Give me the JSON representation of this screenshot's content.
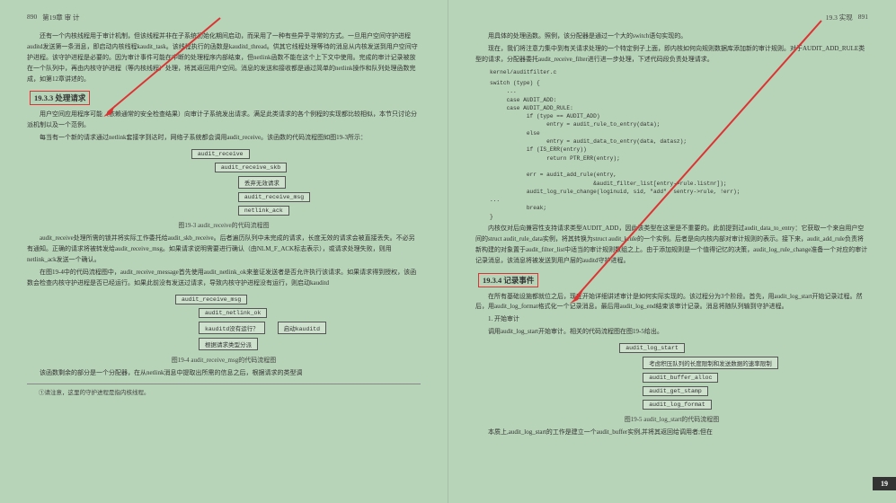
{
  "left_page": {
    "header": {
      "number": "890",
      "chapter": "第19章 审 计"
    },
    "intro_para": "还有一个内核线程用于审计机制，但该线程并非在子系统初始化期间启动，而采用了一种有些异乎寻常的方式。一旦用户空间守护进程auditd发送第一条消息，即启动内核线程kaudit_task。该线程执行的函数是kauditd_thread。供其它线程处理等待的消息从内核发送到用户空间守护进程。该守护进程是必要的。因为审计事件可能在中断的处理程序内部结束，但netlink函数不能在这个上下文中使用。完成的审计记录被放在一个队列中，再由内核守护进程（等内核线程）处理，将其返回用户空间。消息的发送和接收都是通过简单的netlink操作和队列处理函数完成，如第12章讲述的。",
    "section_1933": {
      "num": "19.3.3",
      "title": "处理请求"
    },
    "p1933a": "用户空间应用程序可能（依赖通常的安全检查结果）向审计子系统发出请求。满足此类请求的各个例程的实现都比较相似，本节只讨论分派机制以及一个范例。",
    "p1933b": "每当有一个新的请求通过netlink套接字到达时，网络子系统都会调用audit_receive。该函数的代码流程图如图19-3所示：",
    "diagram193": {
      "caption": "图19-3 audit_receive的代码流程图",
      "n1": "audit_receive",
      "n2": "audit_receive_skb",
      "n3": "丢弃无效请求",
      "n4": "audit_receive_msg",
      "n5": "netlink_ack"
    },
    "p1933c": "audit_receive处理所需的锁并将实际工作委托给audit_skb_receive。后者遍历队列中未完成的请求，长度无效的请求会被直接丢失。不必另有通知。正确的请求将被转发给audit_receive_msg。如果请求说明需要进行确认（由NLM_F_ACK标志表示），或请求处理失败，则用netlink_ack发送一个确认。",
    "p1933d": "在图19-4中的代码流程图中，audit_receive_message首先使用audit_netlink_ok来鉴证发送者是否允许执行该请求。如果请求得到授权，该函数会检查内核守护进程是否已经运行。如果此前没有发送过请求，导致内核守护进程没有运行，则启动kauditd",
    "diagram194": {
      "caption": "图19-4 audit_receive_msg的代码流程图",
      "n1": "audit_receive_msg",
      "n2": "audit_netlink_ok",
      "n3": "kauditd没有运行？",
      "n3b": "启动kauditd",
      "n4": "根据请求类型分派"
    },
    "p1933e": "该函数剩余的部分是一个分配器，在从netlink消息中提取出所需的信息之后，根据请求的类型调",
    "footnote": "①请注意，这里的守护进程是指内核线程。"
  },
  "right_page": {
    "header": {
      "section": "19.3 实现",
      "number": "891"
    },
    "intro": "用具体的处理函数。照例，该分配器是通过一个大的switch语句实现的。",
    "p2": "现在，我们将注意力集中到有关请求处理的一个特定例子上面，即内核如何向规则数据库添加新的审计规则。对于AUDIT_ADD_RULE类型的请求，分配器委托audit_receive_filter进行进一步处理，下述代码段负责处理请求。",
    "code1_path": "kernel/auditfilter.c",
    "code1_sw": "switch (type) {\n     ...\n     case AUDIT_ADD:\n     case AUDIT_ADD_RULE:\n           if (type == AUDIT_ADD)\n                 entry = audit_rule_to_entry(data);\n           else\n                 entry = audit_data_to_entry(data, datasz);\n           if (IS_ERR(entry))\n                 return PTR_ERR(entry);\n\n           err = audit_add_rule(entry,\n                               &audit_filter_list[entry->rule.listnr]);\n           audit_log_rule_change(loginuid, sid, \"add\", sentry->rule, !err);\n...\n           break;\n}",
    "p3": "内核仅对后向兼容性支持请求类型AUDIT_ADD，因此该类型在这里是不重要的。此前提到过audit_data_to_entry：它获取一个来自用户空间的struct audit_rule_data实例，将其转换为struct audit_krule的一个实例。后者是向内核内部对审计规则的表示。接下来，audit_add_rule负责将新构建的对象置于audit_filter_list中适当的审计规则数组之上。由于添加规则是一个值得记忆的决策，audit_log_rule_change准备一个对应的审计记录消息，该消息将被发送到用户层的auditd守护进程。",
    "section_1934": {
      "num": "19.3.4",
      "title": "记录事件"
    },
    "p1934a": "在所有基础设施都就位之后，现在开始详细讲述审计是如何实际实现的。该过程分为3个阶段。首先，用audit_log_start开始记录过程。然后，用audit_log_format格式化一个记录消息。最后用audit_log_end结束该审计记录。消息将随队列输到守护进程。",
    "list1": "1. 开始审计",
    "p1934b": "调用audit_log_start开始审计。相关的代码流程图在图19-5给出。",
    "diagram195": {
      "caption": "图19-5 audit_log_start的代码流程图",
      "n1": "audit_log_start",
      "n2": "考虑积压队列的长度限制和发送数据的速率限制",
      "n3": "audit_buffer_alloc",
      "n4": "audit_get_stamp",
      "n5": "audit_log_format"
    },
    "p1934c": "本质上,audit_log_start的工作是建立一个audit_buffer实例,并将其返回给调用者;但在"
  },
  "tab": "19"
}
